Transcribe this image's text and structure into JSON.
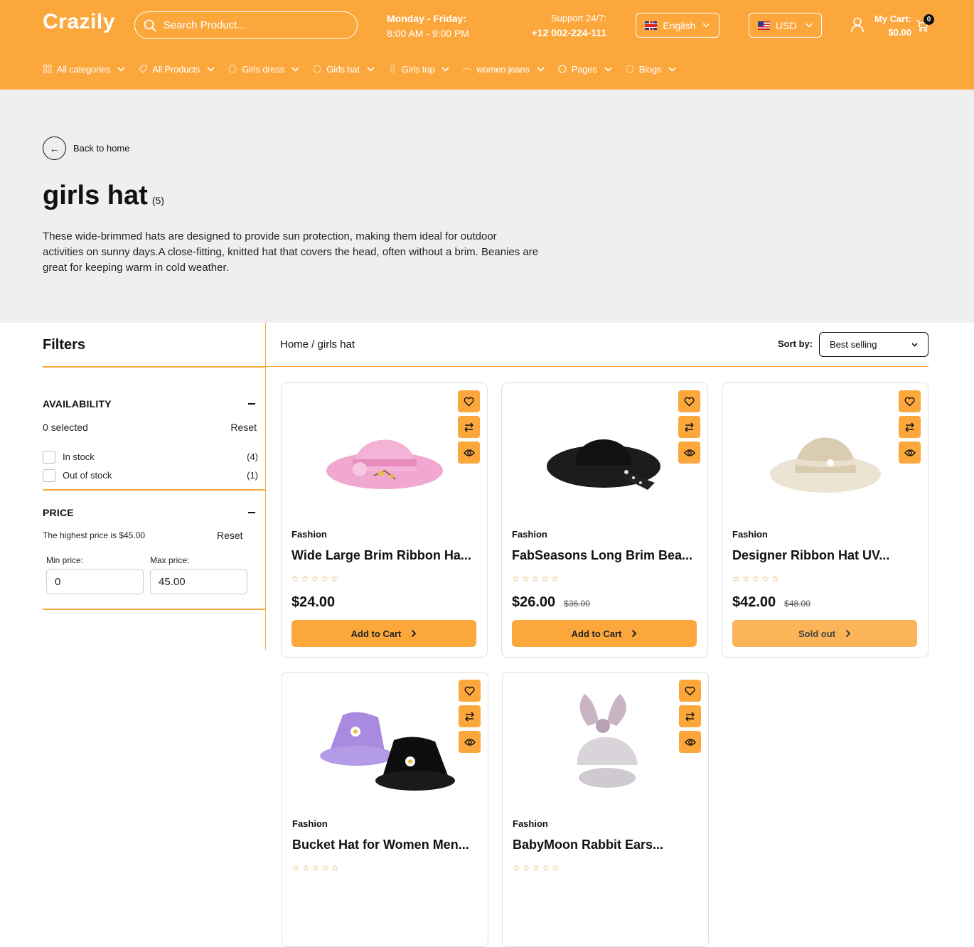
{
  "header": {
    "logo": "Crazily",
    "search_placeholder": "Search Product...",
    "hours_title": "Monday - Friday:",
    "hours_value": "8:00 AM - 9:00 PM",
    "support_title": "Support 24/7:",
    "support_phone": "+12 002-224-111",
    "language": "English",
    "currency": "USD",
    "cart_label": "My Cart:",
    "cart_total": "$0.00",
    "cart_count": "0",
    "brand_color": "#fca73c"
  },
  "nav": [
    {
      "label": "All categories",
      "icon": "grid-icon"
    },
    {
      "label": "All Products",
      "icon": "tag-icon"
    },
    {
      "label": "Girls dress",
      "icon": "dress-icon"
    },
    {
      "label": "Girls hat",
      "icon": "hat-icon"
    },
    {
      "label": "Girls top",
      "icon": "top-icon"
    },
    {
      "label": "women jeans",
      "icon": "jeans-icon"
    },
    {
      "label": "Pages",
      "icon": "circle-icon"
    },
    {
      "label": "Blogs",
      "icon": "blog-icon"
    }
  ],
  "hero": {
    "back_label": "Back to home",
    "title": "girls hat",
    "count": "(5)",
    "description": "These wide-brimmed hats are designed to provide sun protection, making them ideal for outdoor activities on sunny days.A close-fitting, knitted hat that covers the head, often without a brim. Beanies are great for keeping warm in cold weather."
  },
  "filters": {
    "title": "Filters",
    "availability": {
      "title": "AVAILABILITY",
      "selected": "0 selected",
      "reset": "Reset",
      "options": [
        {
          "label": "In stock",
          "count": "(4)"
        },
        {
          "label": "Out of stock",
          "count": "(1)"
        }
      ]
    },
    "price": {
      "title": "PRICE",
      "highest": "The highest price is $45.00",
      "reset": "Reset",
      "min_label": "Min price:",
      "max_label": "Max price:",
      "min_value": "0",
      "max_value": "45.00"
    }
  },
  "toolbar": {
    "breadcrumb_home": "Home /",
    "breadcrumb_current": "girls hat",
    "sort_label": "Sort by:",
    "sort_value": "Best selling"
  },
  "products": [
    {
      "category": "Fashion",
      "name": "Wide Large Brim Ribbon Ha...",
      "price": "$24.00",
      "old_price": "",
      "rating": "☆☆☆☆☆",
      "button": "Add to Cart"
    },
    {
      "category": "Fashion",
      "name": "FabSeasons Long Brim Bea...",
      "price": "$26.00",
      "old_price": "$36.00",
      "rating": "☆☆☆☆☆",
      "button": "Add to Cart"
    },
    {
      "category": "Fashion",
      "name": "Designer Ribbon Hat UV...",
      "price": "$42.00",
      "old_price": "$48.00",
      "rating": "☆☆☆☆☆",
      "button": "Sold out"
    },
    {
      "category": "Fashion",
      "name": "Bucket Hat for Women Men...",
      "rating": "☆☆☆☆☆"
    },
    {
      "category": "Fashion",
      "name": "BabyMoon Rabbit Ears...",
      "rating": "☆☆☆☆☆"
    }
  ]
}
